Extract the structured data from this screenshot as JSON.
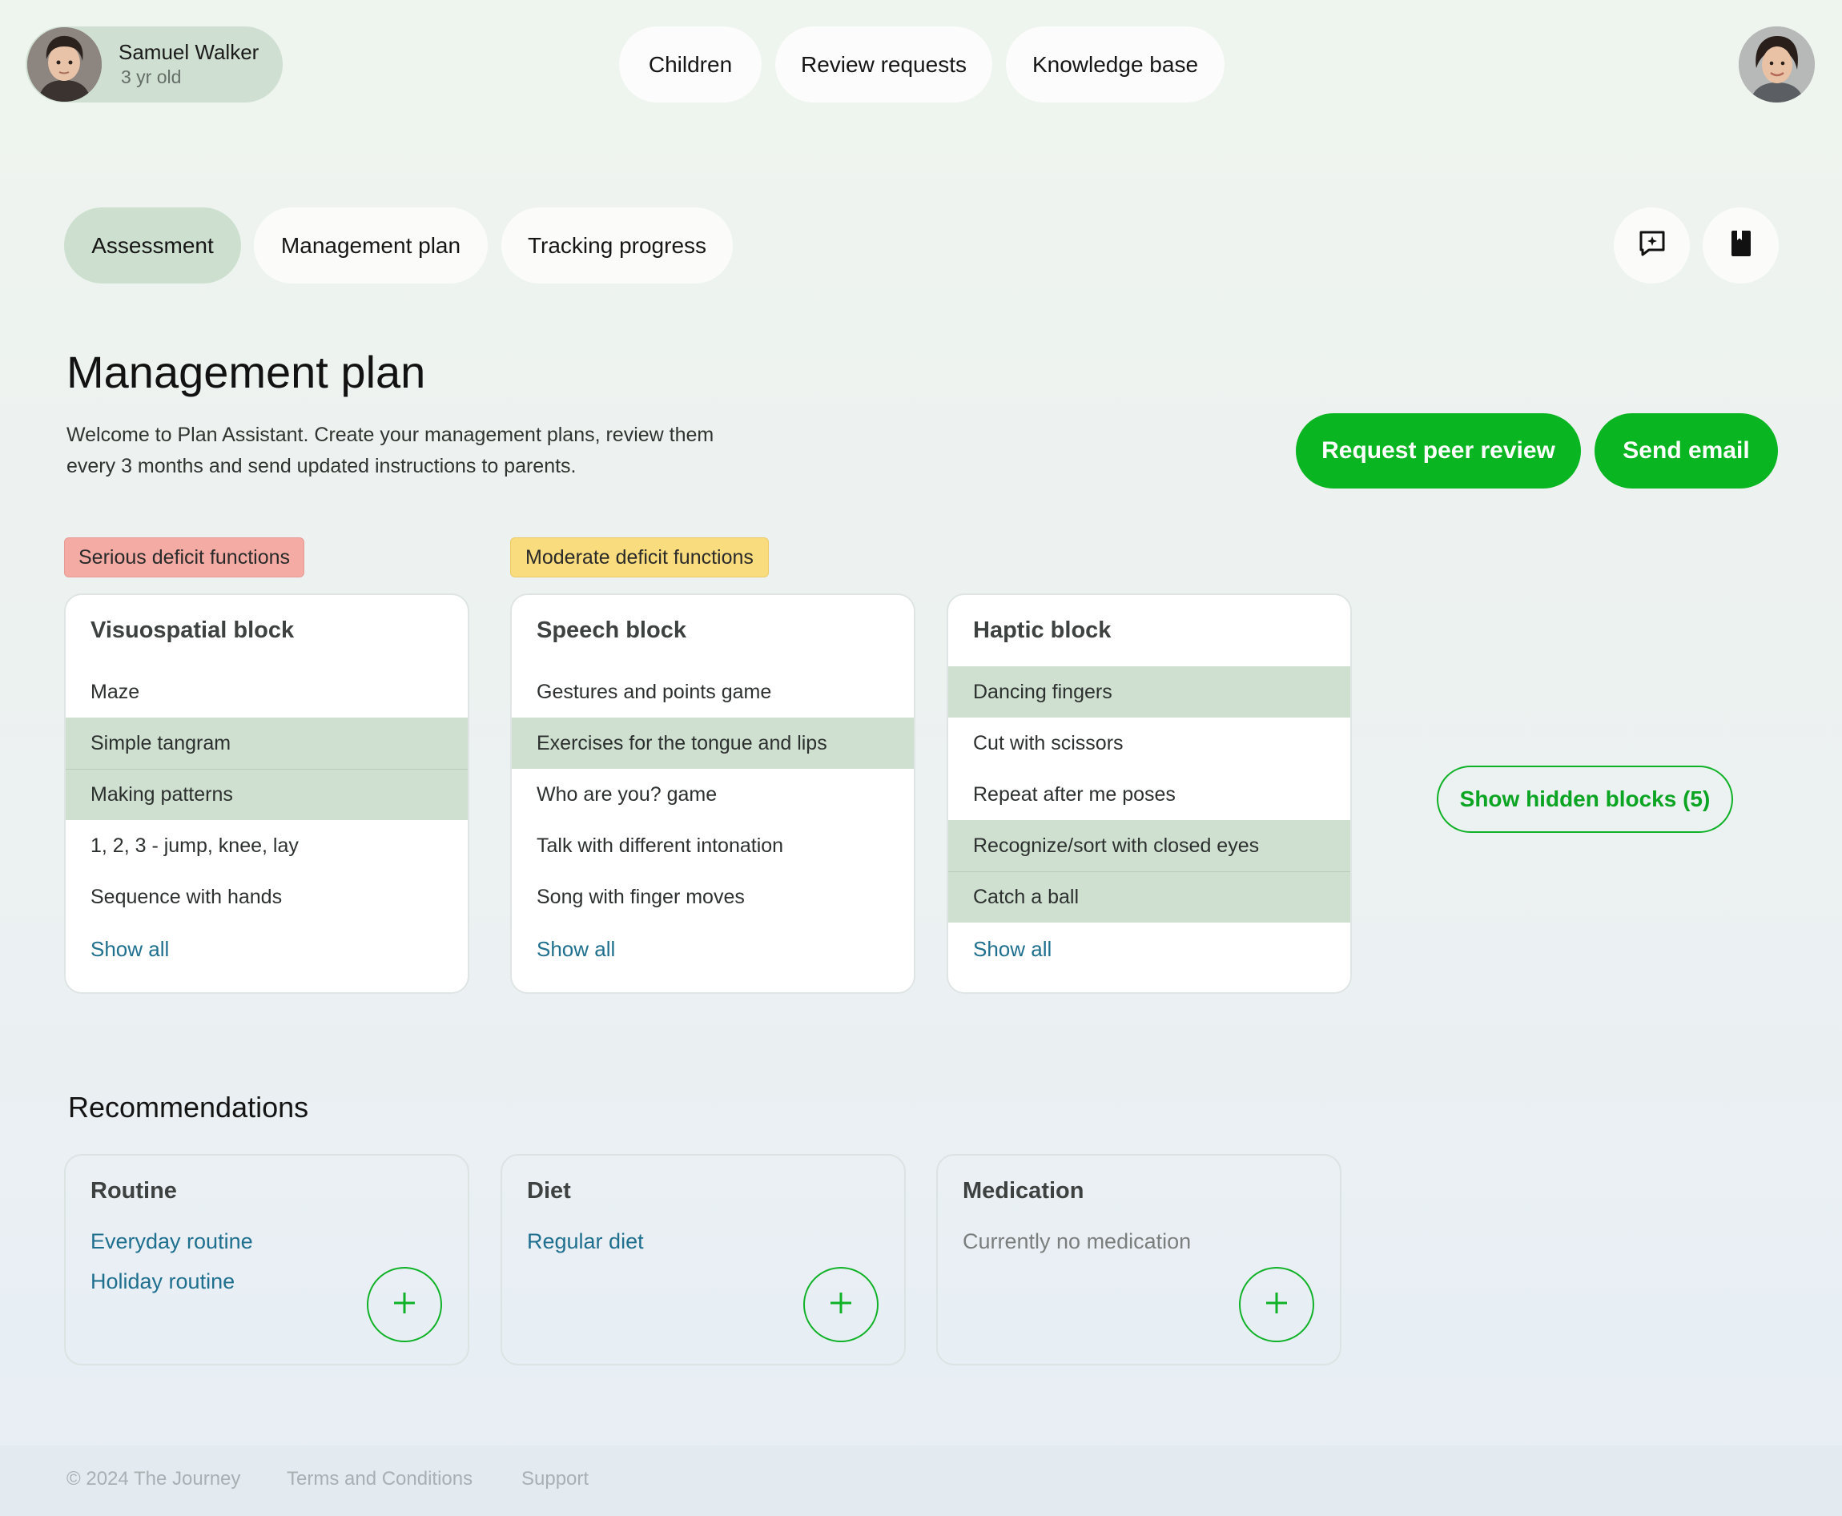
{
  "header": {
    "child": {
      "name": "Samuel Walker",
      "age": "3 yr old"
    },
    "nav": [
      {
        "label": "Children"
      },
      {
        "label": "Review requests"
      },
      {
        "label": "Knowledge base"
      }
    ]
  },
  "tabs": [
    {
      "label": "Assessment",
      "active": true
    },
    {
      "label": "Management plan",
      "active": false
    },
    {
      "label": "Tracking progress",
      "active": false
    }
  ],
  "toolbar": {
    "icons": [
      "comment-plus-icon",
      "book-icon"
    ]
  },
  "page": {
    "title": "Management plan",
    "description": "Welcome to Plan Assistant. Create your management plans, review them every 3 months and send updated instructions to parents.",
    "request_review_label": "Request peer review",
    "send_email_label": "Send email"
  },
  "badges": {
    "serious": "Serious deficit functions",
    "moderate": "Moderate deficit functions"
  },
  "blocks": [
    {
      "title": "Visuospatial block",
      "items": [
        {
          "label": "Maze",
          "selected": false
        },
        {
          "label": "Simple tangram",
          "selected": true
        },
        {
          "label": "Making patterns",
          "selected": true
        },
        {
          "label": "1, 2, 3 - jump, knee, lay",
          "selected": false
        },
        {
          "label": "Sequence with hands",
          "selected": false
        }
      ],
      "show_all": "Show all"
    },
    {
      "title": "Speech block",
      "items": [
        {
          "label": "Gestures and points game",
          "selected": false
        },
        {
          "label": "Exercises for the tongue and lips",
          "selected": true
        },
        {
          "label": "Who are you? game",
          "selected": false
        },
        {
          "label": "Talk with different intonation",
          "selected": false
        },
        {
          "label": "Song with finger moves",
          "selected": false
        }
      ],
      "show_all": "Show all"
    },
    {
      "title": "Haptic block",
      "items": [
        {
          "label": "Dancing fingers",
          "selected": true
        },
        {
          "label": "Cut with scissors",
          "selected": false
        },
        {
          "label": "Repeat after me poses",
          "selected": false
        },
        {
          "label": "Recognize/sort with closed eyes",
          "selected": true
        },
        {
          "label": "Catch a ball",
          "selected": true
        }
      ],
      "show_all": "Show all"
    }
  ],
  "show_hidden_label": "Show hidden blocks (5)",
  "recommendations": {
    "heading": "Recommendations",
    "routine": {
      "title": "Routine",
      "links": [
        "Everyday routine",
        "Holiday routine"
      ]
    },
    "diet": {
      "title": "Diet",
      "links": [
        "Regular diet"
      ]
    },
    "medication": {
      "title": "Medication",
      "empty": "Currently no medication"
    }
  },
  "footer": {
    "copyright": "© 2024 The Journey",
    "terms": "Terms and Conditions",
    "support": "Support"
  },
  "colors": {
    "accent_green": "#09b520",
    "selected_row": "#cfe0d1",
    "link_blue": "#1f6f8f",
    "serious_badge": "#f3aba4",
    "moderate_badge": "#f9dc7d"
  }
}
